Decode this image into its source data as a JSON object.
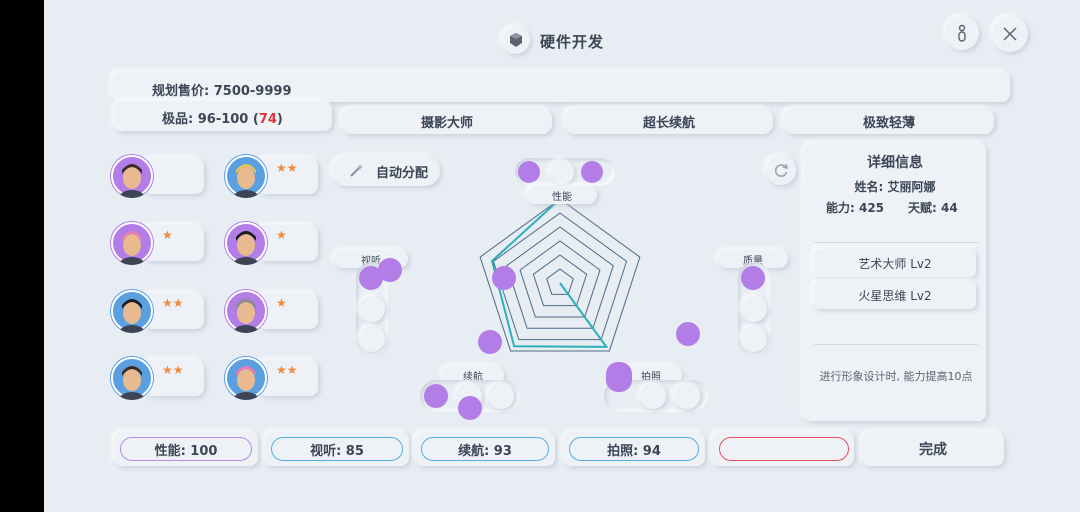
{
  "header": {
    "title": "硬件开发",
    "box_icon": "cube-icon",
    "help_icon": "key-icon",
    "close_icon": "close-icon"
  },
  "price": {
    "label": "规划售价: 7500-9999"
  },
  "quality": {
    "prefix": "极品: 96-100 (",
    "value": "74",
    "suffix": ")",
    "value_color": "#e0343c"
  },
  "tags": [
    "摄影大师",
    "超长续航",
    "极致轻薄"
  ],
  "auto_assign": {
    "label": "自动分配",
    "icon": "magic-wand-icon"
  },
  "refresh_icon": "refresh-icon",
  "staff": [
    {
      "stars": "",
      "hair": "dark",
      "bg": "purple"
    },
    {
      "stars": "★★",
      "hair": "blonde",
      "bg": "blue"
    },
    {
      "stars": "★",
      "hair": "pink",
      "bg": "purple"
    },
    {
      "stars": "★",
      "hair": "black",
      "bg": "purple"
    },
    {
      "stars": "★★",
      "hair": "black",
      "bg": "blue"
    },
    {
      "stars": "★",
      "hair": "gray",
      "bg": "purple"
    },
    {
      "stars": "★★",
      "hair": "dark",
      "bg": "blue"
    },
    {
      "stars": "★★",
      "hair": "pink",
      "bg": "blue"
    }
  ],
  "radar": {
    "labels": {
      "perf": "性能",
      "av": "视听",
      "quality": "质量",
      "battery": "续航",
      "photo": "拍照"
    },
    "values": {
      "perf": 100,
      "av": 85,
      "battery": 93,
      "photo": 94,
      "quality": 0
    }
  },
  "detail": {
    "title": "详细信息",
    "name": "姓名: 艾丽阿娜",
    "ability": "能力: 425",
    "talent": "天赋: 44",
    "skills": [
      "艺术大师 Lv2",
      "火星思维 Lv2"
    ],
    "desc": "进行形象设计时, 能力提高10点"
  },
  "stats": {
    "perf": "性能: 100",
    "av": "视听: 85",
    "battery": "续航: 93",
    "photo": "拍照: 94",
    "empty": "",
    "done": "完成"
  },
  "colors": {
    "accent": "#2ab0b8",
    "stat_perf": "#b58ce6",
    "stat_av": "#4fb0e0",
    "stat_battery": "#4fb0e0",
    "stat_photo": "#4fb0e0",
    "stat_empty": "#e05060"
  }
}
